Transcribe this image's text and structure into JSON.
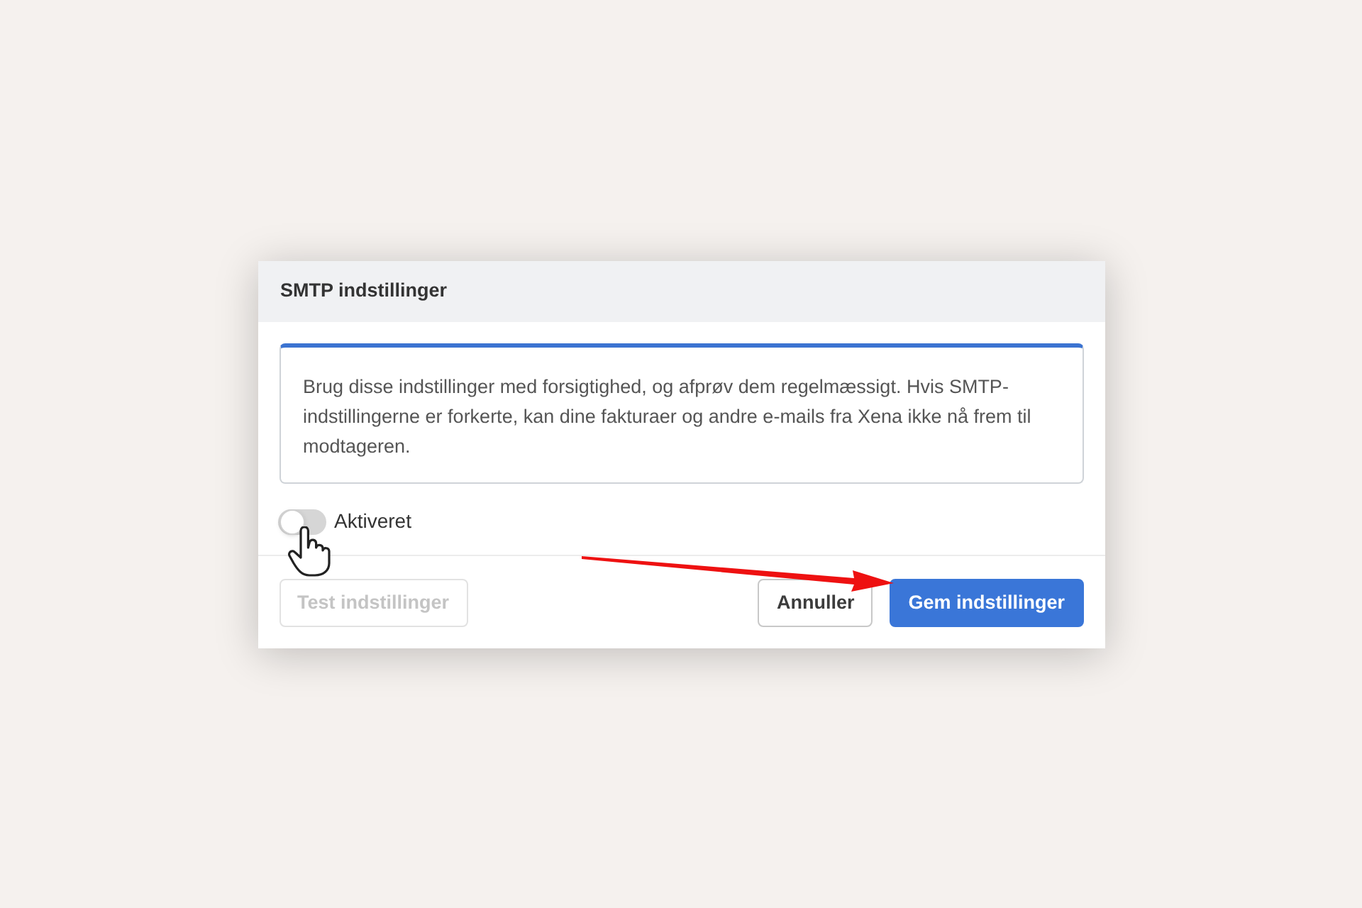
{
  "dialog": {
    "title": "SMTP indstillinger",
    "notice": "Brug disse indstillinger med forsigtighed, og afprøv dem regelmæssigt. Hvis SMTP-indstillingerne er forkerte, kan dine fakturaer og andre e-mails fra Xena ikke nå frem til modtageren.",
    "toggle": {
      "label": "Aktiveret",
      "on": false
    }
  },
  "footer": {
    "left": [
      {
        "label": "Test indstillinger",
        "kind": "secondary",
        "disabled": true
      }
    ],
    "right": [
      {
        "label": "Annuller",
        "kind": "secondary",
        "disabled": false
      },
      {
        "label": "Gem indstillinger",
        "kind": "primary",
        "disabled": false
      }
    ]
  }
}
